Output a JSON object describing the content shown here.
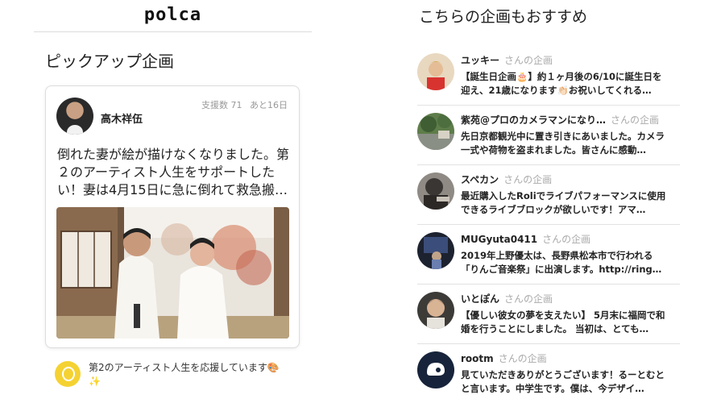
{
  "left": {
    "logo": "polca",
    "section_title": "ピックアップ企画",
    "card": {
      "name": "高木祥伍",
      "stats_supporters": "支援数 71",
      "stats_remaining": "あと16日",
      "description": "倒れた妻が絵が描けなくなりました。第２のアーティスト人生をサポートしたい！妻は4月15日に急に倒れて救急搬…"
    },
    "support_text": "第2のアーティスト人生を応援しています🎨✨"
  },
  "right": {
    "title": "こちらの企画もおすすめ",
    "items": [
      {
        "name": "ユッキー",
        "suffix": "さんの企画",
        "desc": "【誕生日企画🎂】約１ヶ月後の6/10に誕生日を迎え、21歳になります👏🏻お祝いしてくれる…"
      },
      {
        "name": "紫苑@プロのカメラマンになり…",
        "suffix": "さんの企画",
        "desc": "先日京都観光中に置き引きにあいました。カメラ一式や荷物を盗まれました。皆さんに感動…"
      },
      {
        "name": "スペカン",
        "suffix": "さんの企画",
        "desc": "最近購入したRoliでライブパフォーマンスに使用できるライブブロックが欲しいです！アマ…"
      },
      {
        "name": "MUGyuta0411",
        "suffix": "さんの企画",
        "desc": "2019年上野優太は、長野県松本市で行われる「りんご音楽祭」に出演します。http://ring…"
      },
      {
        "name": "いとぽん",
        "suffix": "さんの企画",
        "desc": "【優しい彼女の夢を支えたい】 5月末に福岡で和婚を行うことにしました。 当初は、とても…"
      },
      {
        "name": "rootm",
        "suffix": "さんの企画",
        "desc": "見ていただきありがとうございます！るーとむとと言います。中学生です。僕は、今デザイ…"
      }
    ]
  },
  "colors": {
    "accent_yellow": "#f5d232",
    "text": "#222222",
    "muted": "#999999",
    "divider": "#e2e2e2"
  },
  "icons": {
    "support": "polca-coin-icon"
  }
}
